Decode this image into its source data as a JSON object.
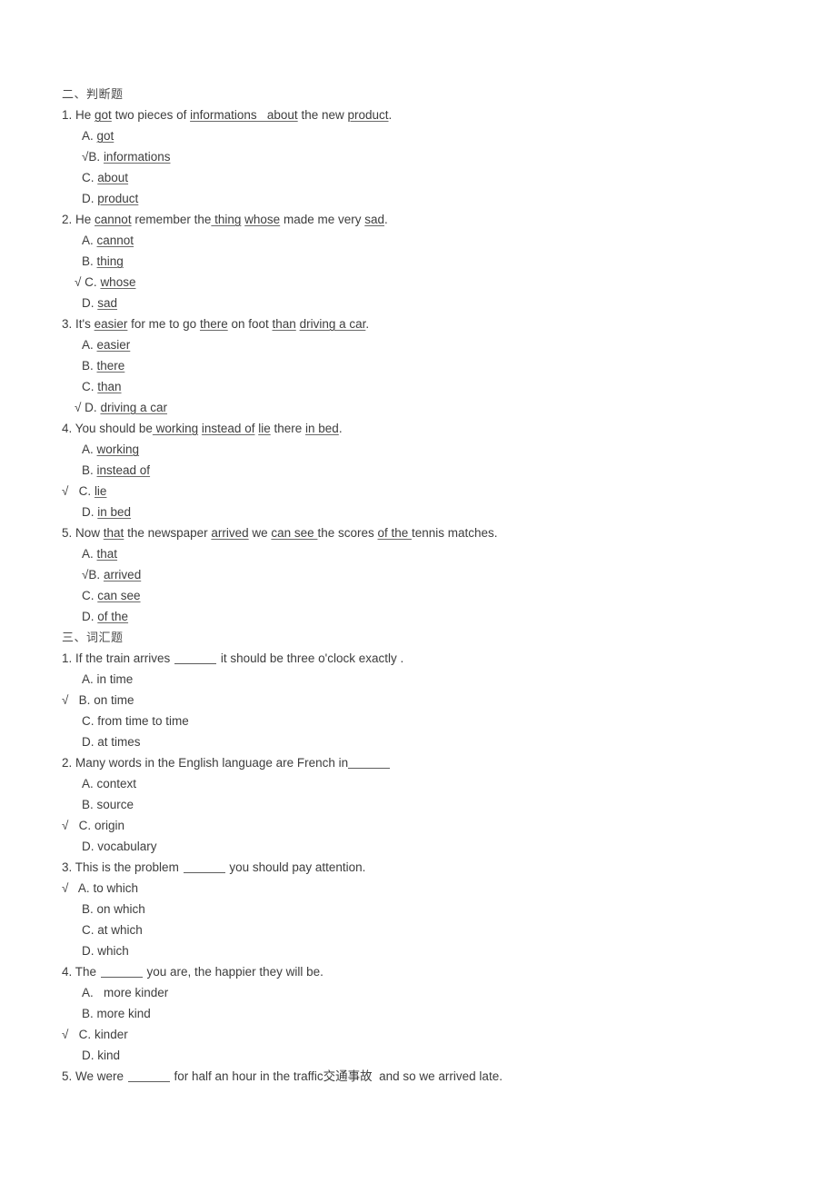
{
  "document": {
    "background_color": "#ffffff",
    "text_color": "#3d3d3d",
    "tick_mark": "√"
  },
  "sections": [
    {
      "heading": "二、判断题",
      "type": "error-identification",
      "questions": [
        {
          "number": "1.",
          "prompt_parts": [
            {
              "text": "He ",
              "underlined": false
            },
            {
              "text": "got",
              "underlined": true
            },
            {
              "text": " two pieces of ",
              "underlined": false
            },
            {
              "text": "informations   about",
              "underlined": true
            },
            {
              "text": " the new ",
              "underlined": false
            },
            {
              "text": "product",
              "underlined": true
            },
            {
              "text": ".",
              "underlined": false
            }
          ],
          "prompt_plain": "1. He got two pieces of informations   about the new product.",
          "options": [
            {
              "letter": "A.",
              "text": "got",
              "underlined": true,
              "checked": false,
              "tick_style": "none"
            },
            {
              "letter": "B.",
              "text": "informations",
              "underlined": true,
              "checked": true,
              "tick_style": "tight"
            },
            {
              "letter": "C.",
              "text": "about",
              "underlined": true,
              "checked": false,
              "tick_style": "none"
            },
            {
              "letter": "D.",
              "text": "product",
              "underlined": true,
              "checked": false,
              "tick_style": "none"
            }
          ],
          "answer": "B"
        },
        {
          "number": "2.",
          "prompt_parts": [
            {
              "text": "He ",
              "underlined": false
            },
            {
              "text": "cannot",
              "underlined": true
            },
            {
              "text": " remember the",
              "underlined": false
            },
            {
              "text": " thing",
              "underlined": true
            },
            {
              "text": " ",
              "underlined": false
            },
            {
              "text": "whose",
              "underlined": true
            },
            {
              "text": " made me very ",
              "underlined": false
            },
            {
              "text": "sad",
              "underlined": true
            },
            {
              "text": ".",
              "underlined": false
            }
          ],
          "prompt_plain": "2. He cannot remember the thing whose made me very sad.",
          "options": [
            {
              "letter": "A.",
              "text": "cannot",
              "underlined": true,
              "checked": false,
              "tick_style": "none"
            },
            {
              "letter": "B.",
              "text": "thing",
              "underlined": true,
              "checked": false,
              "tick_style": "none"
            },
            {
              "letter": "C.",
              "text": "whose",
              "underlined": true,
              "checked": true,
              "tick_style": "space"
            },
            {
              "letter": "D.",
              "text": "sad",
              "underlined": true,
              "checked": false,
              "tick_style": "none"
            }
          ],
          "answer": "C"
        },
        {
          "number": "3.",
          "prompt_parts": [
            {
              "text": "It's ",
              "underlined": false
            },
            {
              "text": "easier",
              "underlined": true
            },
            {
              "text": " for me to go ",
              "underlined": false
            },
            {
              "text": "there",
              "underlined": true
            },
            {
              "text": " on foot ",
              "underlined": false
            },
            {
              "text": "than",
              "underlined": true
            },
            {
              "text": " ",
              "underlined": false
            },
            {
              "text": "driving a car",
              "underlined": true
            },
            {
              "text": ".",
              "underlined": false
            }
          ],
          "prompt_plain": "3. It's easier for me to go there on foot than driving a car.",
          "options": [
            {
              "letter": "A.",
              "text": "easier",
              "underlined": true,
              "checked": false,
              "tick_style": "none"
            },
            {
              "letter": "B.",
              "text": "there",
              "underlined": true,
              "checked": false,
              "tick_style": "none"
            },
            {
              "letter": "C.",
              "text": "than",
              "underlined": true,
              "checked": false,
              "tick_style": "none"
            },
            {
              "letter": "D.",
              "text": "driving a car",
              "underlined": true,
              "checked": true,
              "tick_style": "space"
            }
          ],
          "answer": "D"
        },
        {
          "number": "4.",
          "prompt_parts": [
            {
              "text": "You should be",
              "underlined": false
            },
            {
              "text": " working",
              "underlined": true
            },
            {
              "text": " ",
              "underlined": false
            },
            {
              "text": "instead of",
              "underlined": true
            },
            {
              "text": " ",
              "underlined": false
            },
            {
              "text": "lie",
              "underlined": true
            },
            {
              "text": " there ",
              "underlined": false
            },
            {
              "text": "in bed",
              "underlined": true
            },
            {
              "text": ".",
              "underlined": false
            }
          ],
          "prompt_plain": "4. You should be working instead of lie there in bed.",
          "options": [
            {
              "letter": "A.",
              "text": "working",
              "underlined": true,
              "checked": false,
              "tick_style": "none"
            },
            {
              "letter": "B.",
              "text": "instead of",
              "underlined": true,
              "checked": false,
              "tick_style": "none"
            },
            {
              "letter": "C.",
              "text": "lie",
              "underlined": true,
              "checked": true,
              "tick_style": "margin"
            },
            {
              "letter": "D.",
              "text": "in bed",
              "underlined": true,
              "checked": false,
              "tick_style": "none"
            }
          ],
          "answer": "C"
        },
        {
          "number": "5.",
          "prompt_parts": [
            {
              "text": "Now ",
              "underlined": false
            },
            {
              "text": "that",
              "underlined": true
            },
            {
              "text": " the newspaper ",
              "underlined": false
            },
            {
              "text": "arrived",
              "underlined": true
            },
            {
              "text": " we ",
              "underlined": false
            },
            {
              "text": "can see ",
              "underlined": true
            },
            {
              "text": "the scores ",
              "underlined": false
            },
            {
              "text": "of the ",
              "underlined": true
            },
            {
              "text": "tennis matches.",
              "underlined": false
            }
          ],
          "prompt_plain": "5. Now that the newspaper arrived we can see the scores of the tennis matches.",
          "options": [
            {
              "letter": "A.",
              "text": "that",
              "underlined": true,
              "checked": false,
              "tick_style": "none"
            },
            {
              "letter": "B.",
              "text": "arrived",
              "underlined": true,
              "checked": true,
              "tick_style": "tight"
            },
            {
              "letter": "C.",
              "text": "can see",
              "underlined": true,
              "checked": false,
              "tick_style": "none"
            },
            {
              "letter": "D.",
              "text": "of the",
              "underlined": true,
              "checked": false,
              "tick_style": "none"
            }
          ],
          "answer": "B"
        }
      ]
    },
    {
      "heading": "三、词汇题",
      "type": "vocabulary-blank",
      "questions": [
        {
          "number": "1.",
          "prompt_before": "1. If the train arrives ",
          "prompt_after": " it should be three o'clock exactly .",
          "blank_tight": false,
          "prompt_plain": "1. If the train arrives ______ it should be three o'clock exactly .",
          "options": [
            {
              "letter": "A.",
              "text": "in time",
              "underlined": false,
              "checked": false,
              "tick_style": "none"
            },
            {
              "letter": "B.",
              "text": "on time",
              "underlined": false,
              "checked": true,
              "tick_style": "margin"
            },
            {
              "letter": "C.",
              "text": "from time to time",
              "underlined": false,
              "checked": false,
              "tick_style": "none"
            },
            {
              "letter": "D.",
              "text": "at times",
              "underlined": false,
              "checked": false,
              "tick_style": "none"
            }
          ],
          "answer": "B"
        },
        {
          "number": "2.",
          "prompt_before": "2. Many words in the English language are French in",
          "prompt_after": "",
          "blank_tight": true,
          "prompt_plain": "2. Many words in the English language are French in______",
          "options": [
            {
              "letter": "A.",
              "text": "context",
              "underlined": false,
              "checked": false,
              "tick_style": "none"
            },
            {
              "letter": "B.",
              "text": "source",
              "underlined": false,
              "checked": false,
              "tick_style": "none"
            },
            {
              "letter": "C.",
              "text": "origin",
              "underlined": false,
              "checked": true,
              "tick_style": "margin"
            },
            {
              "letter": "D.",
              "text": "vocabulary",
              "underlined": false,
              "checked": false,
              "tick_style": "none"
            }
          ],
          "answer": "C"
        },
        {
          "number": "3.",
          "prompt_before": "3. This is the problem ",
          "prompt_after": " you should pay attention.",
          "blank_tight": false,
          "prompt_plain": "3. This is the problem ______ you should pay attention.",
          "options": [
            {
              "letter": "A.",
              "text": "to which",
              "underlined": false,
              "checked": true,
              "tick_style": "margin"
            },
            {
              "letter": "B.",
              "text": "on which",
              "underlined": false,
              "checked": false,
              "tick_style": "none"
            },
            {
              "letter": "C.",
              "text": "at which",
              "underlined": false,
              "checked": false,
              "tick_style": "none"
            },
            {
              "letter": "D.",
              "text": "which",
              "underlined": false,
              "checked": false,
              "tick_style": "none"
            }
          ],
          "answer": "A"
        },
        {
          "number": "4.",
          "prompt_before": "4. The ",
          "prompt_after": " you are, the happier they will be.",
          "blank_tight": false,
          "prompt_plain": "4. The ______ you are, the happier they will be.",
          "options": [
            {
              "letter": "A.",
              "text": "  more kinder",
              "underlined": false,
              "checked": false,
              "tick_style": "none"
            },
            {
              "letter": "B.",
              "text": "more kind",
              "underlined": false,
              "checked": false,
              "tick_style": "none"
            },
            {
              "letter": "C.",
              "text": "kinder",
              "underlined": false,
              "checked": true,
              "tick_style": "margin"
            },
            {
              "letter": "D.",
              "text": "kind",
              "underlined": false,
              "checked": false,
              "tick_style": "none"
            }
          ],
          "answer": "C"
        },
        {
          "number": "5.",
          "prompt_before": "5. We were ",
          "prompt_after": " for half an hour in the traffic交通事故  and so we arrived late.",
          "blank_tight": false,
          "prompt_plain": "5. We were ______ for half an hour in the traffic交通事故  and so we arrived late.",
          "options": [],
          "answer": ""
        }
      ]
    }
  ]
}
